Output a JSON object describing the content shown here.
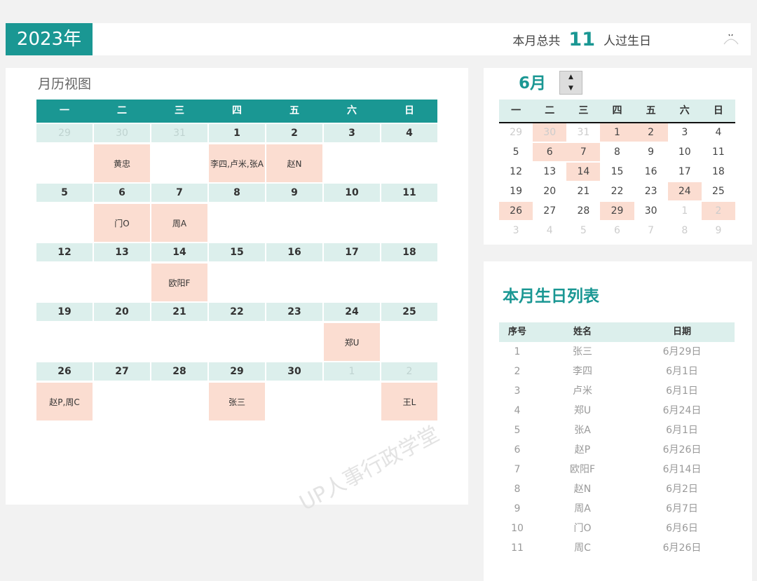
{
  "header": {
    "year": "2023年",
    "summary_prefix": "本月总共",
    "count": "11",
    "summary_suffix": "人过生日"
  },
  "calendar": {
    "title": "月历视图",
    "weekdays": [
      "一",
      "二",
      "三",
      "四",
      "五",
      "六",
      "日"
    ],
    "weeks": [
      {
        "days": [
          {
            "n": "29",
            "o": true
          },
          {
            "n": "30",
            "o": true
          },
          {
            "n": "31",
            "o": true
          },
          {
            "n": "1"
          },
          {
            "n": "2"
          },
          {
            "n": "3"
          },
          {
            "n": "4"
          }
        ],
        "names": [
          "",
          "黄忠",
          "",
          "李四,卢米,张A",
          "赵N",
          "",
          ""
        ]
      },
      {
        "days": [
          {
            "n": "5"
          },
          {
            "n": "6"
          },
          {
            "n": "7"
          },
          {
            "n": "8"
          },
          {
            "n": "9"
          },
          {
            "n": "10"
          },
          {
            "n": "11"
          }
        ],
        "names": [
          "",
          "门O",
          "周A",
          "",
          "",
          "",
          ""
        ]
      },
      {
        "days": [
          {
            "n": "12"
          },
          {
            "n": "13"
          },
          {
            "n": "14"
          },
          {
            "n": "15"
          },
          {
            "n": "16"
          },
          {
            "n": "17"
          },
          {
            "n": "18"
          }
        ],
        "names": [
          "",
          "",
          "欧阳F",
          "",
          "",
          "",
          ""
        ]
      },
      {
        "days": [
          {
            "n": "19"
          },
          {
            "n": "20"
          },
          {
            "n": "21"
          },
          {
            "n": "22"
          },
          {
            "n": "23"
          },
          {
            "n": "24"
          },
          {
            "n": "25"
          }
        ],
        "names": [
          "",
          "",
          "",
          "",
          "",
          "郑U",
          ""
        ]
      },
      {
        "days": [
          {
            "n": "26"
          },
          {
            "n": "27"
          },
          {
            "n": "28"
          },
          {
            "n": "29"
          },
          {
            "n": "30"
          },
          {
            "n": "1",
            "o": true
          },
          {
            "n": "2",
            "o": true
          }
        ],
        "names": [
          "赵P,周C",
          "",
          "",
          "张三",
          "",
          "",
          "王L"
        ]
      }
    ]
  },
  "mini": {
    "month": "6月",
    "weekdays": [
      "一",
      "二",
      "三",
      "四",
      "五",
      "六",
      "日"
    ],
    "rows": [
      [
        {
          "n": "29",
          "o": true
        },
        {
          "n": "30",
          "o": true,
          "b": true
        },
        {
          "n": "31",
          "o": true
        },
        {
          "n": "1",
          "b": true
        },
        {
          "n": "2",
          "b": true
        },
        {
          "n": "3"
        },
        {
          "n": "4"
        }
      ],
      [
        {
          "n": "5"
        },
        {
          "n": "6",
          "b": true
        },
        {
          "n": "7",
          "b": true
        },
        {
          "n": "8"
        },
        {
          "n": "9"
        },
        {
          "n": "10"
        },
        {
          "n": "11"
        }
      ],
      [
        {
          "n": "12"
        },
        {
          "n": "13"
        },
        {
          "n": "14",
          "b": true
        },
        {
          "n": "15"
        },
        {
          "n": "16"
        },
        {
          "n": "17"
        },
        {
          "n": "18"
        }
      ],
      [
        {
          "n": "19"
        },
        {
          "n": "20"
        },
        {
          "n": "21"
        },
        {
          "n": "22"
        },
        {
          "n": "23"
        },
        {
          "n": "24",
          "b": true
        },
        {
          "n": "25"
        }
      ],
      [
        {
          "n": "26",
          "b": true
        },
        {
          "n": "27"
        },
        {
          "n": "28"
        },
        {
          "n": "29",
          "b": true
        },
        {
          "n": "30"
        },
        {
          "n": "1",
          "o": true
        },
        {
          "n": "2",
          "o": true,
          "b": true
        }
      ],
      [
        {
          "n": "3",
          "o": true
        },
        {
          "n": "4",
          "o": true
        },
        {
          "n": "5",
          "o": true
        },
        {
          "n": "6",
          "o": true
        },
        {
          "n": "7",
          "o": true
        },
        {
          "n": "8",
          "o": true
        },
        {
          "n": "9",
          "o": true
        }
      ]
    ]
  },
  "list": {
    "title": "本月生日列表",
    "headers": [
      "序号",
      "姓名",
      "日期"
    ],
    "rows": [
      [
        "1",
        "张三",
        "6月29日"
      ],
      [
        "2",
        "李四",
        "6月1日"
      ],
      [
        "3",
        "卢米",
        "6月1日"
      ],
      [
        "4",
        "郑U",
        "6月24日"
      ],
      [
        "5",
        "张A",
        "6月1日"
      ],
      [
        "6",
        "赵P",
        "6月26日"
      ],
      [
        "7",
        "欧阳F",
        "6月14日"
      ],
      [
        "8",
        "赵N",
        "6月2日"
      ],
      [
        "9",
        "周A",
        "6月7日"
      ],
      [
        "10",
        "门O",
        "6月6日"
      ],
      [
        "11",
        "周C",
        "6月26日"
      ]
    ]
  },
  "watermark": "UP人事行政学堂",
  "colors": {
    "accent": "#1a9793",
    "light": "#dcefec",
    "highlight": "#fbddd1"
  },
  "icons": {
    "corner": "sparkle-icon"
  }
}
